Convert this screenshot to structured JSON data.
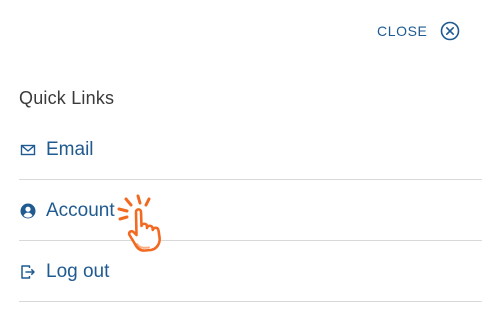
{
  "close": {
    "label": "CLOSE",
    "icon": "close-circle-icon"
  },
  "quick_links": {
    "title": "Quick Links",
    "items": [
      {
        "label": "Email",
        "icon": "mail-icon"
      },
      {
        "label": "Account",
        "icon": "user-circle-icon"
      },
      {
        "label": "Log out",
        "icon": "logout-icon"
      }
    ]
  },
  "colors": {
    "link": "#1f5a91",
    "title": "#3a3a3a",
    "divider": "#d9d9d9",
    "pointer_accent": "#f26a21"
  }
}
